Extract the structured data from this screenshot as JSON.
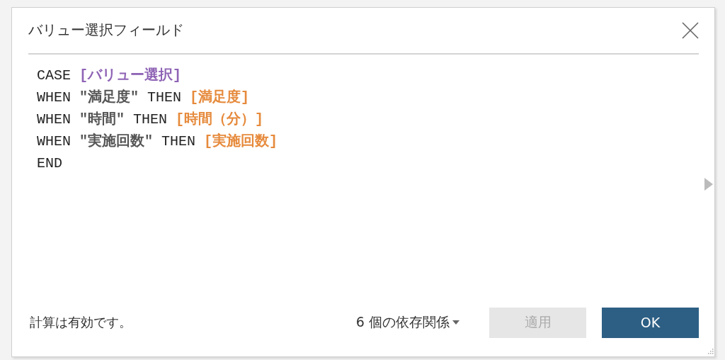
{
  "dialog": {
    "title": "バリュー選択フィールド"
  },
  "code_lines": [
    {
      "tokens": [
        {
          "kind": "keyword",
          "text": "CASE "
        },
        {
          "kind": "parameter",
          "text": "[バリュー選択]"
        }
      ]
    },
    {
      "tokens": [
        {
          "kind": "keyword",
          "text": "WHEN "
        },
        {
          "kind": "string",
          "text": "\"満足度\""
        },
        {
          "kind": "keyword",
          "text": " THEN "
        },
        {
          "kind": "field",
          "text": "[満足度]"
        }
      ]
    },
    {
      "tokens": [
        {
          "kind": "keyword",
          "text": "WHEN "
        },
        {
          "kind": "string",
          "text": "\"時間\""
        },
        {
          "kind": "keyword",
          "text": " THEN "
        },
        {
          "kind": "field",
          "text": "[時間（分）]"
        }
      ]
    },
    {
      "tokens": [
        {
          "kind": "keyword",
          "text": "WHEN "
        },
        {
          "kind": "string",
          "text": "\"実施回数\""
        },
        {
          "kind": "keyword",
          "text": " THEN "
        },
        {
          "kind": "field",
          "text": "[実施回数]"
        }
      ]
    },
    {
      "tokens": [
        {
          "kind": "keyword",
          "text": "END"
        }
      ]
    }
  ],
  "footer": {
    "status": "計算は有効です。",
    "dependencies": "6 個の依存関係",
    "buttons": [
      {
        "label": "適用",
        "kind": "secondary",
        "disabled": true
      },
      {
        "label": "OK",
        "kind": "primary",
        "disabled": false
      }
    ]
  }
}
